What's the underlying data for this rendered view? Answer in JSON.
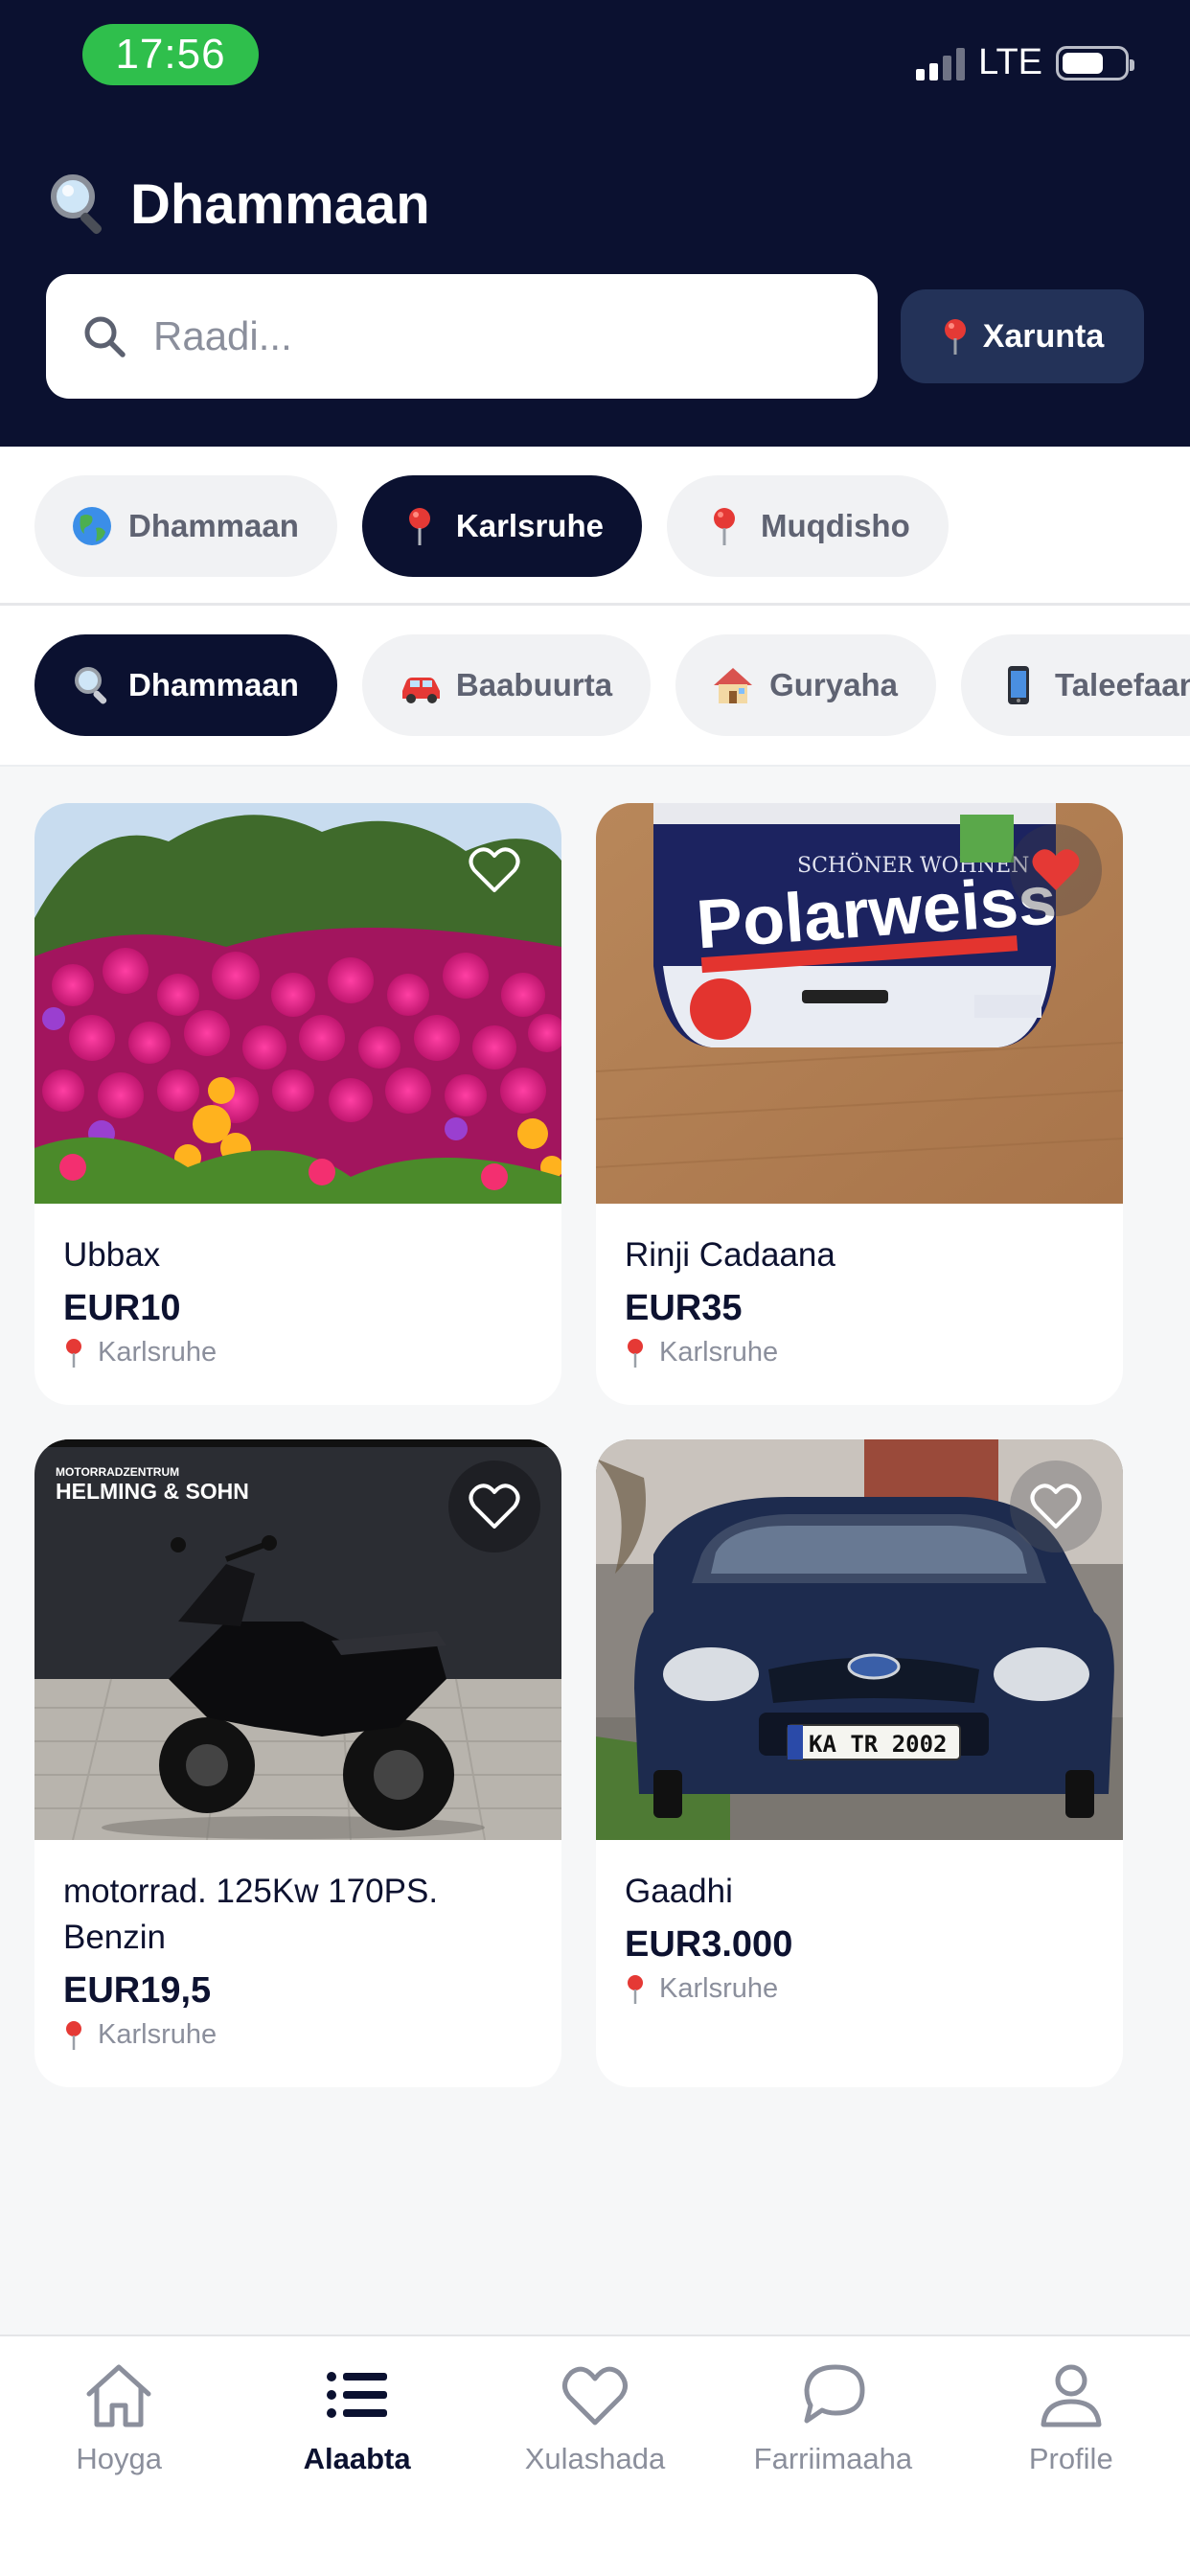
{
  "status_bar": {
    "time": "17:56",
    "network": "LTE",
    "signal_bars_active": 2,
    "signal_bars_total": 4
  },
  "header": {
    "title": "Dhammaan",
    "title_icon": "magnifying-glass-emoji",
    "search": {
      "placeholder": "Raadi...",
      "value": ""
    },
    "location_button": {
      "label": "Xarunta",
      "icon": "pin-icon"
    }
  },
  "city_filters": [
    {
      "label": "Dhammaan",
      "icon": "globe-icon",
      "active": false
    },
    {
      "label": "Karlsruhe",
      "icon": "pin-icon",
      "active": true
    },
    {
      "label": "Muqdisho",
      "icon": "pin-icon",
      "active": false
    }
  ],
  "category_filters": [
    {
      "label": "Dhammaan",
      "icon": "magnifying-glass-emoji",
      "active": true
    },
    {
      "label": "Baabuurta",
      "icon": "car-icon",
      "active": false
    },
    {
      "label": "Guryaha",
      "icon": "house-icon",
      "active": false
    },
    {
      "label": "Taleefaan",
      "icon": "phone-icon",
      "active": false
    }
  ],
  "listings": [
    {
      "title": "Ubbax",
      "price": "EUR10",
      "location": "Karlsruhe",
      "favorited": false,
      "image": "flowers-photo"
    },
    {
      "title": "Rinji Cadaana",
      "price": "EUR35",
      "location": "Karlsruhe",
      "favorited": true,
      "image": "paint-bucket-photo",
      "bucket_brand": "Polarweiss",
      "bucket_maker": "SCHÖNER WOHNEN"
    },
    {
      "title": "motorrad. 125Kw 170PS. Benzin",
      "price": "EUR19,5",
      "location": "Karlsruhe",
      "favorited": false,
      "image": "motorcycle-photo",
      "dealer_small": "MOTORRADZENTRUM",
      "dealer_name": "HELMING & SOHN"
    },
    {
      "title": "Gaadhi",
      "price": "EUR3.000",
      "location": "Karlsruhe",
      "favorited": false,
      "image": "car-photo",
      "plate": "KA TR 2002"
    }
  ],
  "bottom_nav": [
    {
      "label": "Hoyga",
      "icon": "home-icon",
      "active": false
    },
    {
      "label": "Alaabta",
      "icon": "list-icon",
      "active": true
    },
    {
      "label": "Xulashada",
      "icon": "heart-icon",
      "active": false
    },
    {
      "label": "Farriimaaha",
      "icon": "chat-icon",
      "active": false
    },
    {
      "label": "Profile",
      "icon": "person-icon",
      "active": false
    }
  ],
  "colors": {
    "header_bg": "#0b1130",
    "location_button_bg": "#233258",
    "time_pill": "#2fbf4c",
    "favorite_active": "#e53935",
    "page_bg": "#f6f7f8"
  }
}
